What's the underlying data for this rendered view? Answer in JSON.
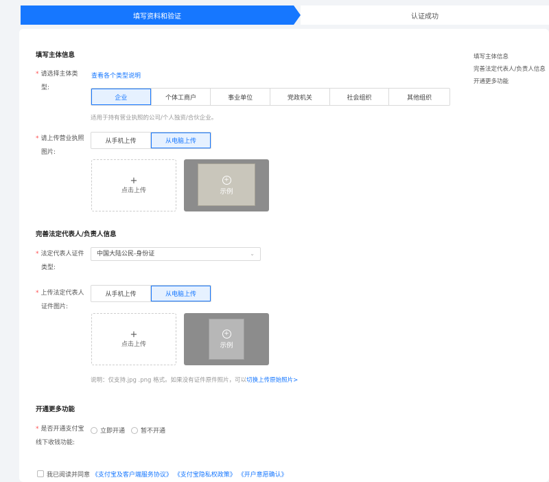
{
  "steps": {
    "active": "填写资料和验证",
    "next": "认证成功"
  },
  "toc": [
    "填写主体信息",
    "完善法定代表人/负责人信息",
    "开通更多功能"
  ],
  "section1": {
    "title": "填写主体信息",
    "type_label_1": "请选择主体类",
    "type_label_2": "型:",
    "type_link": "查看各个类型说明",
    "types": [
      "企业",
      "个体工商户",
      "事业单位",
      "党政机关",
      "社会组织",
      "其他组织"
    ],
    "type_hint": "适用于持有营业执照的公司/个人独资/合伙企业。",
    "license_label_1": "请上传营业执照",
    "license_label_2": "图片:",
    "upload_methods": [
      "从手机上传",
      "从电脑上传"
    ],
    "upload_text": "点击上传",
    "sample_text": "示例"
  },
  "section2": {
    "title": "完善法定代表人/负责人信息",
    "id_type_label_1": "法定代表人证件",
    "id_type_label_2": "类型:",
    "id_type_value": "中国大陆公民-身份证",
    "id_img_label_1": "上传法定代表人",
    "id_img_label_2": "证件图片:",
    "upload_methods": [
      "从手机上传",
      "从电脑上传"
    ],
    "upload_text": "点击上传",
    "sample_text": "示例",
    "note_prefix": "说明：仅支持.jpg .png 格式。如果没有证件原件照片，可以",
    "note_link": "切换上传原始照片>"
  },
  "section3": {
    "title": "开通更多功能",
    "q_label_1": "是否开通支付宝",
    "q_label_2": "线下收钱功能:",
    "options": [
      "立即开通",
      "暂不开通"
    ]
  },
  "agreement": {
    "prefix": "我已阅读并同意",
    "links": [
      "《支付宝及客户端服务协议》",
      "《支付宝隐私权政策》",
      "《开户意愿确认》"
    ]
  },
  "colors": {
    "accent": "#1677ff",
    "required": "#ff4d4f"
  }
}
